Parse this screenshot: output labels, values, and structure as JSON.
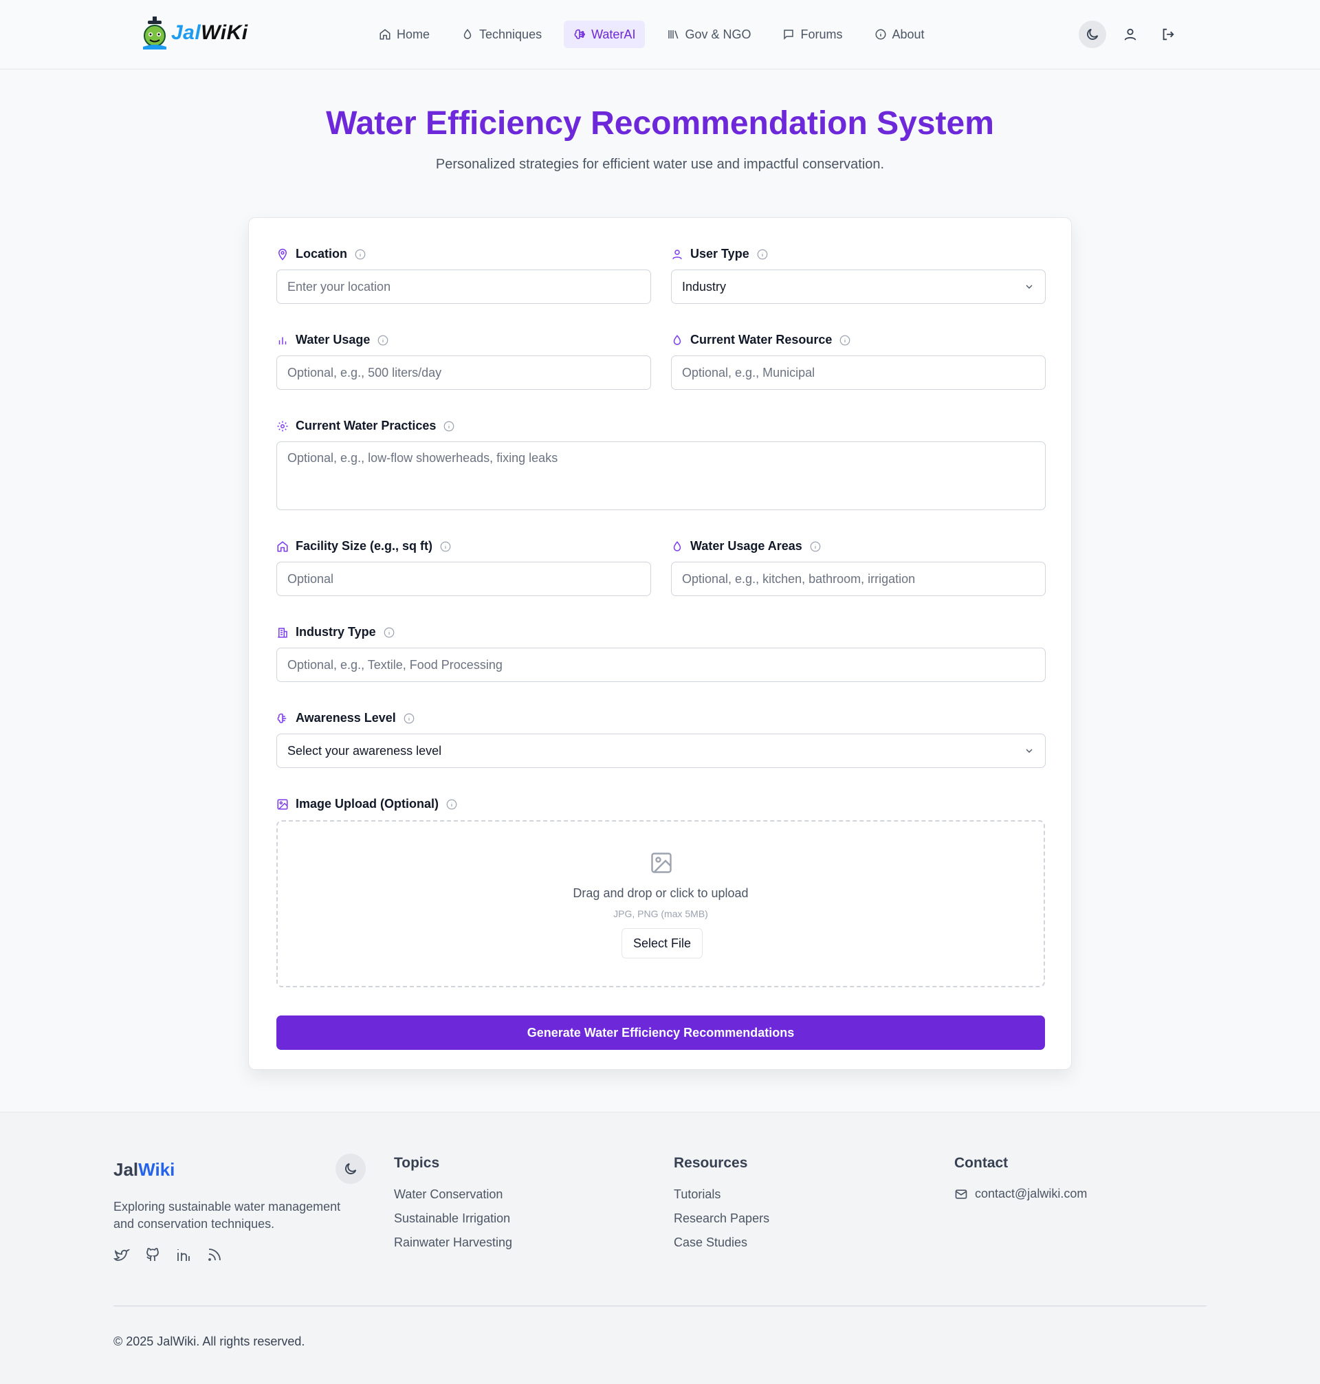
{
  "brand": {
    "part1": "Jal",
    "part2": "WiKi"
  },
  "nav": [
    {
      "label": "Home",
      "icon": "home-icon"
    },
    {
      "label": "Techniques",
      "icon": "droplet-icon"
    },
    {
      "label": "WaterAI",
      "icon": "brain-icon",
      "active": true
    },
    {
      "label": "Gov & NGO",
      "icon": "library-icon"
    },
    {
      "label": "Forums",
      "icon": "message-icon"
    },
    {
      "label": "About",
      "icon": "info-icon"
    }
  ],
  "hero": {
    "title": "Water Efficiency Recommendation System",
    "subtitle": "Personalized strategies for efficient water use and impactful conservation."
  },
  "form": {
    "location": {
      "label": "Location",
      "placeholder": "Enter your location"
    },
    "user_type": {
      "label": "User Type",
      "value": "Industry"
    },
    "water_usage": {
      "label": "Water Usage",
      "placeholder": "Optional, e.g., 500 liters/day"
    },
    "water_resource": {
      "label": "Current Water Resource",
      "placeholder": "Optional, e.g., Municipal"
    },
    "practices": {
      "label": "Current Water Practices",
      "placeholder": "Optional, e.g., low-flow showerheads, fixing leaks"
    },
    "facility_size": {
      "label": "Facility Size (e.g., sq ft)",
      "placeholder": "Optional"
    },
    "usage_areas": {
      "label": "Water Usage Areas",
      "placeholder": "Optional, e.g., kitchen, bathroom, irrigation"
    },
    "industry_type": {
      "label": "Industry Type",
      "placeholder": "Optional, e.g., Textile, Food Processing"
    },
    "awareness": {
      "label": "Awareness Level",
      "value": "Select your awareness level"
    },
    "image_upload": {
      "label": "Image Upload (Optional)",
      "drop_text": "Drag and drop or click to upload",
      "hint": "JPG, PNG (max 5MB)",
      "button": "Select File"
    },
    "submit": "Generate Water Efficiency Recommendations"
  },
  "footer": {
    "brand_part1": "Jal",
    "brand_part2": "Wiki",
    "description": "Exploring sustainable water management and conservation techniques.",
    "topics": {
      "heading": "Topics",
      "links": [
        "Water Conservation",
        "Sustainable Irrigation",
        "Rainwater Harvesting"
      ]
    },
    "resources": {
      "heading": "Resources",
      "links": [
        "Tutorials",
        "Research Papers",
        "Case Studies"
      ]
    },
    "contact": {
      "heading": "Contact",
      "email": "contact@jalwiki.com"
    },
    "copyright": "© 2025 JalWiki. All rights reserved."
  },
  "colors": {
    "accent": "#6d28d9",
    "brand_blue": "#1d9bf0",
    "footer_blue": "#2563eb"
  }
}
